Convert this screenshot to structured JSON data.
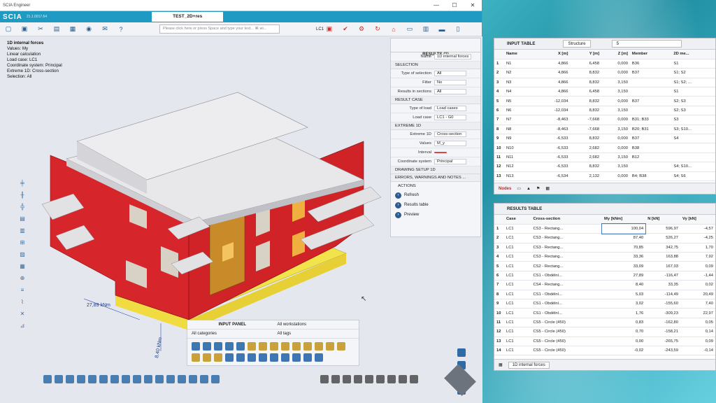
{
  "window": {
    "app_title": "SCIA Engineer",
    "logo": "SCIA",
    "version": "21.1.0017.64",
    "doc_tab": "TEST_2D+res",
    "command_placeholder": "Please click here or press Space and type your text... ⌘ wi...",
    "load_case_selector": "LC1"
  },
  "viewport_info": {
    "title": "1D internal forces",
    "lines": [
      "Values: My",
      "Linear calculation",
      "Load case: LC1",
      "Coordinate system: Principal",
      "Extreme 1D: Cross-section",
      "Selection: All"
    ],
    "dim_label_1": "27,89 kNm",
    "dim_label_2": "8,40 kNm"
  },
  "results_panel": {
    "title": "RESULTS (1)",
    "name_label": "Name",
    "name_value": "1D internal forces",
    "sections": {
      "selection": "SELECTION",
      "result_case": "RESULT CASE",
      "extreme": "EXTREME 1D",
      "drawing": "DRAWING SETUP 1D",
      "errors": "ERRORS, WARNINGS AND NOTES ...",
      "actions": "ACTIONS"
    },
    "rows": {
      "type_of_selection": {
        "k": "Type of selection",
        "v": "All"
      },
      "filter": {
        "k": "Filter",
        "v": "No"
      },
      "results_in_sections": {
        "k": "Results in sections",
        "v": "All"
      },
      "type_of_load": {
        "k": "Type of load",
        "v": "Load cases"
      },
      "load_case": {
        "k": "Load case",
        "v": "LC1 - G0"
      },
      "extreme_1d": {
        "k": "Extreme 1D",
        "v": "Cross-section"
      },
      "values": {
        "k": "Values",
        "v": "M_y"
      },
      "interval": {
        "k": "Interval",
        "v": ""
      },
      "coordinate_system": {
        "k": "Coordinate system",
        "v": "Principal"
      }
    },
    "actions": [
      "Refresh",
      "Results table",
      "Preview"
    ]
  },
  "input_panel": {
    "title": "INPUT PANEL",
    "workstations": "All workstations",
    "categories": "All categories",
    "tags": "All tags"
  },
  "input_table": {
    "title": "INPUT TABLE",
    "filter_label": "Structure",
    "filter_value": "5",
    "columns": [
      "",
      "Name",
      "X [m]",
      "Y [m]",
      "Z [m]",
      "Member",
      "2D me..."
    ],
    "rows": [
      [
        "1",
        "N1",
        "4,866",
        "6,458",
        "0,000",
        "B36",
        "S1"
      ],
      [
        "2",
        "N2",
        "4,866",
        "8,832",
        "0,000",
        "B37",
        "S1; S2"
      ],
      [
        "3",
        "N3",
        "4,866",
        "8,832",
        "3,150",
        "",
        "S1; S2; ..."
      ],
      [
        "4",
        "N4",
        "4,866",
        "6,458",
        "3,150",
        "",
        "S1"
      ],
      [
        "5",
        "N5",
        "-12,034",
        "8,832",
        "0,000",
        "B37",
        "S2; S3"
      ],
      [
        "6",
        "N6",
        "-12,034",
        "8,832",
        "3,150",
        "",
        "S2; S3"
      ],
      [
        "7",
        "N7",
        "-8,463",
        "-7,668",
        "0,000",
        "B31; B33",
        "S3"
      ],
      [
        "8",
        "N8",
        "-8,463",
        "-7,668",
        "3,150",
        "B20; B31",
        "S3; S10..."
      ],
      [
        "9",
        "N9",
        "-6,533",
        "8,832",
        "0,000",
        "B37",
        "S4"
      ],
      [
        "10",
        "N10",
        "-6,533",
        "2,682",
        "0,000",
        "B38",
        ""
      ],
      [
        "11",
        "N11",
        "-6,533",
        "2,682",
        "3,150",
        "B12",
        ""
      ],
      [
        "12",
        "N12",
        "-6,533",
        "8,832",
        "3,150",
        "",
        "S4; S10..."
      ],
      [
        "13",
        "N13",
        "-6,534",
        "2,132",
        "0,000",
        "B4; B38",
        "S4; S6"
      ]
    ],
    "footer_tab": "Nodes"
  },
  "results_table": {
    "title": "RESULTS TABLE",
    "columns": [
      "",
      "Case",
      "Cross-section",
      "My [kNm]",
      "N [kN]",
      "Vy [kN]"
    ],
    "rows": [
      [
        "1",
        "LC1",
        "CS3 - Rectang...",
        "100,04",
        "596,97",
        "-4,57"
      ],
      [
        "2",
        "LC1",
        "CS3 - Rectang...",
        "87,40",
        "526,27",
        "-4,25"
      ],
      [
        "3",
        "LC1",
        "CS3 - Rectang...",
        "70,85",
        "342,75",
        "1,70"
      ],
      [
        "4",
        "LC1",
        "CS3 - Rectang...",
        "33,36",
        "163,88",
        "7,92"
      ],
      [
        "5",
        "LC1",
        "CS2 - Rectang...",
        "33,09",
        "167,03",
        "0,09"
      ],
      [
        "6",
        "LC1",
        "CS1 - Obdélní...",
        "27,89",
        "-116,47",
        "-1,44"
      ],
      [
        "7",
        "LC1",
        "CS4 - Rectang...",
        "8,40",
        "33,35",
        "0,02"
      ],
      [
        "8",
        "LC1",
        "CS1 - Obdélní...",
        "5,03",
        "-114,49",
        "20,49"
      ],
      [
        "9",
        "LC1",
        "CS1 - Obdélní...",
        "3,02",
        "-155,60",
        "7,40"
      ],
      [
        "10",
        "LC1",
        "CS1 - Obdélní...",
        "1,76",
        "-309,23",
        "22,97"
      ],
      [
        "11",
        "LC1",
        "CS5 - Circle (450)",
        "0,83",
        "-162,80",
        "0,05"
      ],
      [
        "12",
        "LC1",
        "CS5 - Circle (450)",
        "0,70",
        "-158,21",
        "0,14"
      ],
      [
        "13",
        "LC1",
        "CS5 - Circle (450)",
        "0,00",
        "-265,75",
        "0,09"
      ],
      [
        "14",
        "LC1",
        "CS5 - Circle (450)",
        "-0,02",
        "-243,59",
        "-0,14"
      ]
    ],
    "footer_tab": "1D internal forces"
  },
  "colors": {
    "brand": "#1f9ac2",
    "wall": "#d7262b",
    "slab": "#e8e8ea",
    "column": "#c98a2a"
  }
}
